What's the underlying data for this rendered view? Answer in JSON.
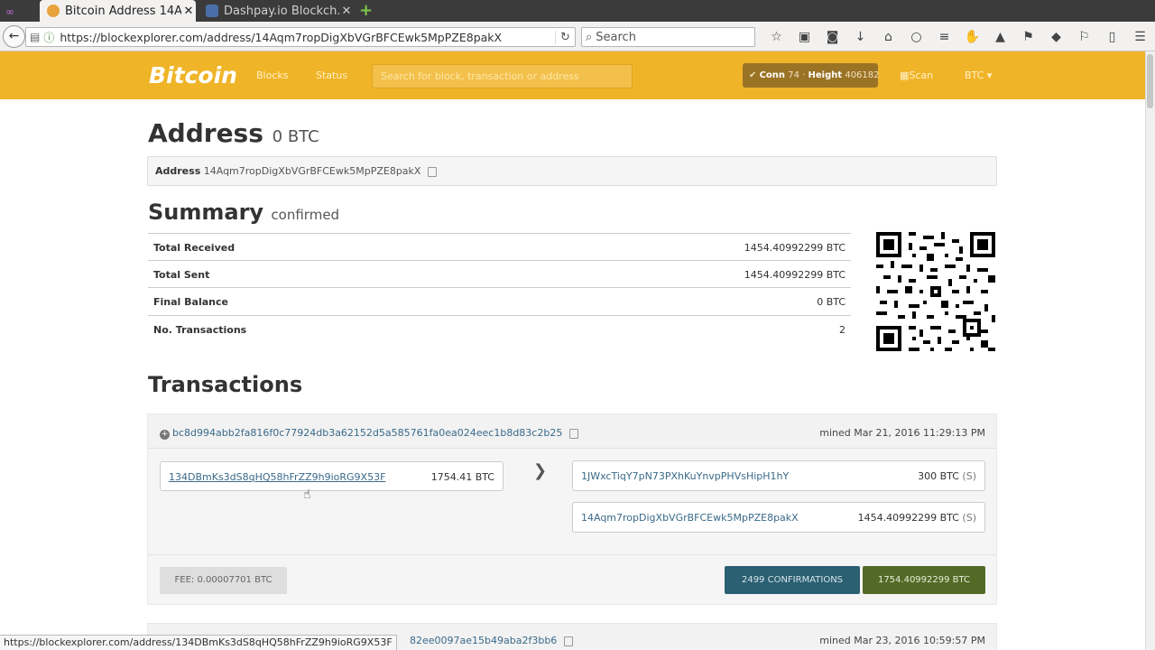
{
  "browser": {
    "tabs": [
      {
        "title": "Bitcoin Address 14A...",
        "active": true
      },
      {
        "title": "Dashpay.io Blockch...",
        "active": false
      }
    ],
    "url": "https://blockexplorer.com/address/14Aqm7ropDigXbVGrBFCEwk5MpPZE8pakX",
    "search_placeholder": "Search",
    "status_url": "https://blockexplorer.com/address/134DBmKs3dS8qHQ58hFrZZ9h9ioRG9X53F"
  },
  "site": {
    "brand": "Bitcoin",
    "nav": [
      "Blocks",
      "Status"
    ],
    "search_placeholder": "Search for block, transaction or address",
    "conn_label": "Conn",
    "conn_value": "74",
    "height_label": "Height",
    "height_value": "406182",
    "scan_label": "Scan",
    "currency": "BTC"
  },
  "address": {
    "heading": "Address",
    "balance": "0 BTC",
    "label": "Address",
    "value": "14Aqm7ropDigXbVGrBFCEwk5MpPZE8pakX"
  },
  "summary": {
    "heading": "Summary",
    "status": "confirmed",
    "rows": [
      {
        "key": "Total Received",
        "value": "1454.40992299 BTC"
      },
      {
        "key": "Total Sent",
        "value": "1454.40992299 BTC"
      },
      {
        "key": "Final Balance",
        "value": "0 BTC"
      },
      {
        "key": "No. Transactions",
        "value": "2"
      }
    ]
  },
  "transactions": {
    "heading": "Transactions",
    "items": [
      {
        "hash": "bc8d994abb2fa816f0c77924db3a62152d5a585761fa0ea024eec1b8d83c2b25",
        "mined": "mined Mar 21, 2016 11:29:13 PM",
        "input": {
          "address": "134DBmKs3dS8qHQ58hFrZZ9h9ioRG9X53F",
          "amount": "1754.41 BTC"
        },
        "outputs": [
          {
            "address": "1JWxcTiqY7pN73PXhKuYnvpPHVsHipH1hY",
            "amount": "300 BTC",
            "flag": "(S)"
          },
          {
            "address": "14Aqm7ropDigXbVGrBFCEwk5MpPZE8pakX",
            "amount": "1454.40992299 BTC",
            "flag": "(S)"
          }
        ],
        "fee": "FEE: 0.00007701 BTC",
        "confirmations": "2499 CONFIRMATIONS",
        "total": "1754.40992299 BTC"
      },
      {
        "hash_tail": "82ee0097ae15b49aba2f3bb6",
        "mined": "mined Mar 23, 2016 10:59:57 PM"
      }
    ]
  }
}
